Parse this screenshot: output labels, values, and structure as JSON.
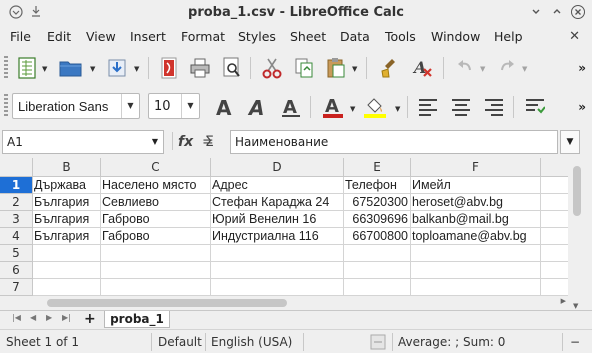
{
  "window": {
    "title": "proba_1.csv - LibreOffice Calc"
  },
  "menu": [
    "File",
    "Edit",
    "View",
    "Insert",
    "Format",
    "Styles",
    "Sheet",
    "Data",
    "Tools",
    "Window",
    "Help"
  ],
  "formatting": {
    "font_name": "Liberation Sans",
    "font_size": "10"
  },
  "formula_bar": {
    "cell_ref": "A1",
    "content": "Наименование",
    "fx": "fx",
    "sigma": "Σ",
    "equals": "="
  },
  "grid": {
    "columns": [
      "B",
      "C",
      "D",
      "E",
      "F"
    ],
    "rows": [
      "1",
      "2",
      "3",
      "4",
      "5",
      "6",
      "7"
    ],
    "data": [
      [
        "Държава",
        "Населено място",
        "Адрес",
        "Телефон",
        "Имейл"
      ],
      [
        "България",
        "Севлиево",
        "Стефан Караджа 24",
        "67520300",
        "heroset@abv.bg"
      ],
      [
        "България",
        "Габрово",
        "Юрий Венелин 16",
        "66309696",
        "balkanb@mail.bg"
      ],
      [
        "България",
        "Габрово",
        "Индустриална 116",
        "66700800",
        "toploamane@abv.bg"
      ]
    ]
  },
  "sheet_tabs": {
    "add": "+",
    "active": "proba_1"
  },
  "status": {
    "sheet": "Sheet 1 of 1",
    "style": "Default",
    "language": "English (USA)",
    "summary": "Average: ; Sum: 0",
    "zoom_minus": "−"
  },
  "colors": {
    "selection_accent": "#1e6fd6",
    "grid_lines": "#d4d4d4"
  }
}
